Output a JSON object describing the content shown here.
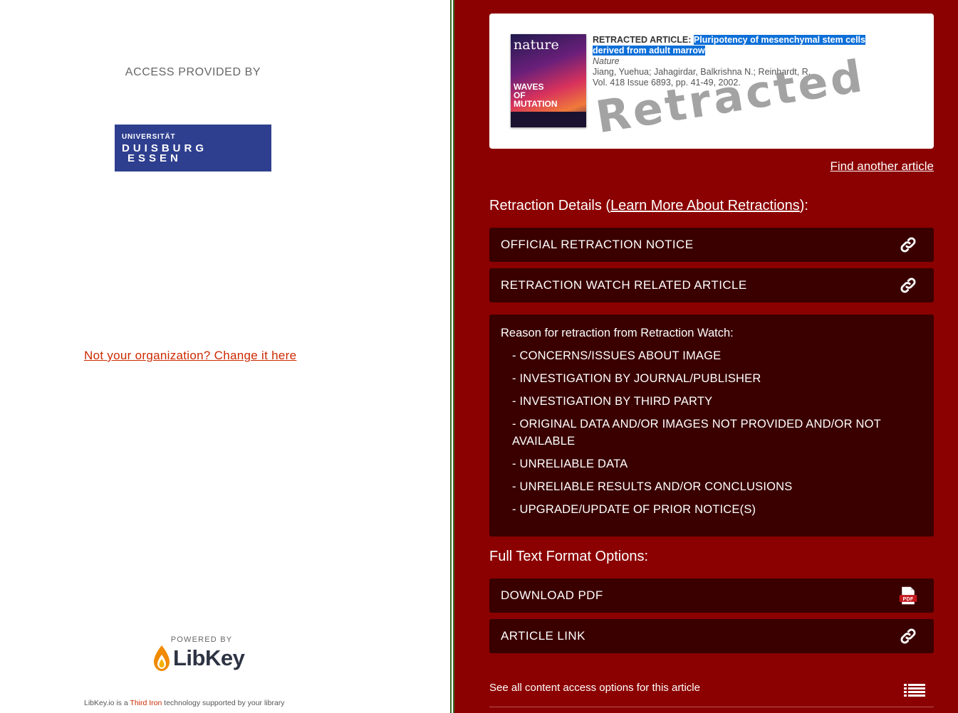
{
  "left": {
    "access_label": "ACCESS PROVIDED BY",
    "institution_logo": {
      "line1": "UNIVERSITÄT",
      "line2": "DUISBURG",
      "line3": "ESSEN",
      "bg_color": "#2f3f8f"
    },
    "change_org_link": "Not your organization? Change it here",
    "powered_by": "POWERED BY",
    "libkey_logo_text": "LibKey",
    "footer": {
      "prefix": "LibKey.io is a",
      "link": "Third Iron",
      "suffix": "technology supported by your library"
    }
  },
  "article": {
    "cover_masthead": "nature",
    "cover_headline": "WAVES OF MUTATION",
    "kind_label": "RETRACTED ARTICLE:",
    "title": "Pluripotency of mesenchymal stem cells derived from adult marrow",
    "journal": "Nature",
    "authors": "Jiang, Yuehua; Jahagirdar, Balkrishna N.; Reinhardt, R.",
    "citation": "Vol. 418 Issue 6893, pp. 41-49, 2002.",
    "stamp": "Retracted",
    "find_another": "Find another article"
  },
  "retraction": {
    "title_prefix": "Retraction Details (",
    "learn_more_link": "Learn More About Retractions",
    "title_suffix": "):",
    "notice_button": "OFFICIAL RETRACTION NOTICE",
    "watch_button": "RETRACTION WATCH RELATED ARTICLE",
    "reason_header": "Reason for retraction from Retraction Watch:",
    "reasons": [
      "- CONCERNS/ISSUES ABOUT IMAGE",
      "- INVESTIGATION BY JOURNAL/PUBLISHER",
      "- INVESTIGATION BY THIRD PARTY",
      "- ORIGINAL DATA AND/OR IMAGES NOT PROVIDED AND/OR NOT AVAILABLE",
      "- UNRELIABLE DATA",
      "- UNRELIABLE RESULTS AND/OR CONCLUSIONS",
      "- UPGRADE/UPDATE OF PRIOR NOTICE(S)"
    ]
  },
  "fulltext": {
    "title": "Full Text Format Options:",
    "pdf_button": "DOWNLOAD PDF",
    "pdf_badge": "PDF",
    "article_link_button": "ARTICLE LINK",
    "see_all": "See all content access options for this article"
  },
  "colors": {
    "panel_bg": "#8b0000",
    "button_bg": "#3a0000",
    "link_red": "#cc2a00",
    "selection_blue": "#0d6fd8"
  },
  "icons": {
    "link": "link-icon",
    "pdf": "pdf-file-icon",
    "list": "list-icon",
    "libkey_drop": "flame-drop-icon"
  }
}
